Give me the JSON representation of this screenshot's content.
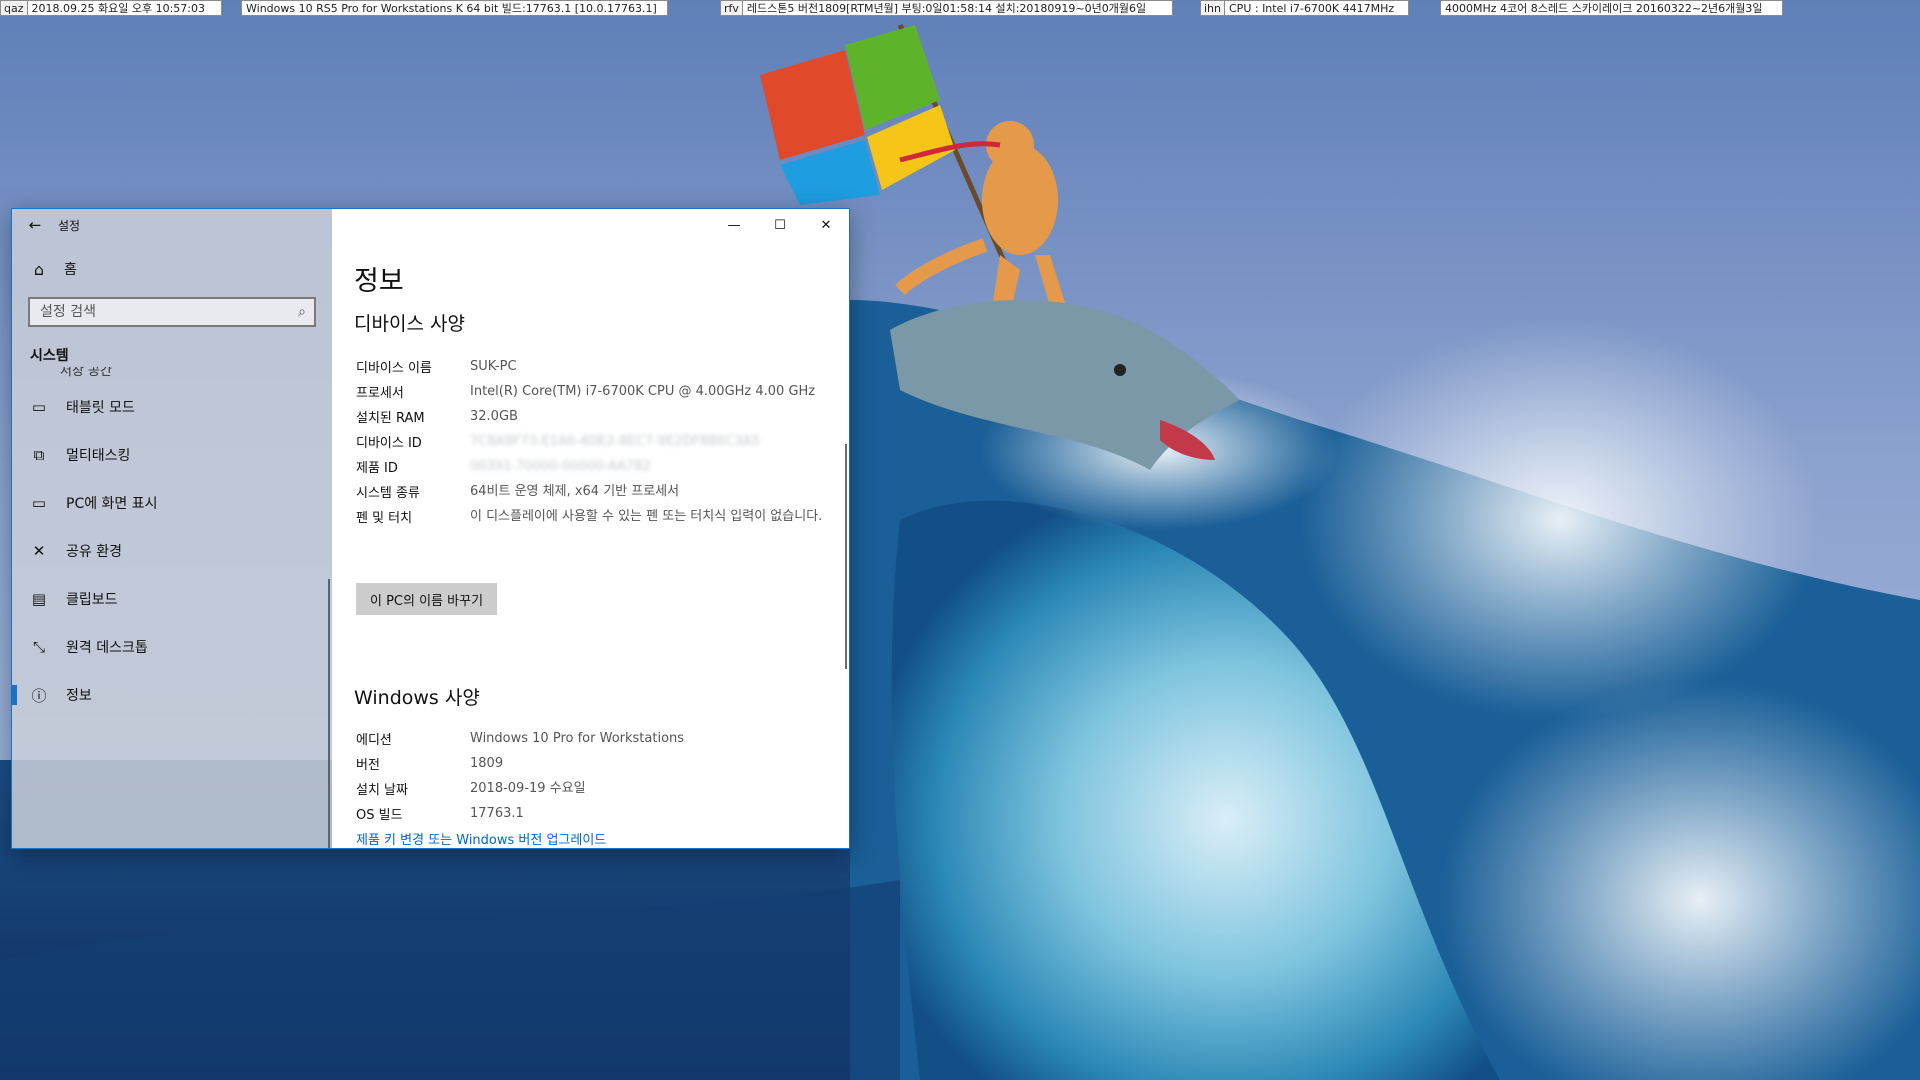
{
  "taskbar_info": [
    {
      "tag": "qaz",
      "value": "2018.09.25 화요일 오후 10:57:03"
    },
    {
      "tag": "",
      "value": "Windows 10 RS5 Pro for Workstations K 64 bit 빌드:17763.1 [10.0.17763.1]"
    },
    {
      "tag": "rfv",
      "value": "레드스톤5 버전1809[RTM년월] 부팅:0일01:58:14 설치:20180919~0년0개월6일"
    },
    {
      "tag": "ihn",
      "value": "CPU : Intel i7-6700K 4417MHz"
    },
    {
      "tag": "",
      "value": "4000MHz 4코어 8스레드 스카이레이크 20160322~2년6개월3일"
    }
  ],
  "window": {
    "title": "설정",
    "nav": {
      "home": "홈",
      "search_placeholder": "설정 검색",
      "section": "시스템",
      "clipped_item": "저장 공간",
      "items": [
        {
          "label": "태블릿 모드",
          "icon": "tablet-icon"
        },
        {
          "label": "멀티태스킹",
          "icon": "multitasking-icon"
        },
        {
          "label": "PC에 화면 표시",
          "icon": "project-icon"
        },
        {
          "label": "공유 환경",
          "icon": "shared-experiences-icon"
        },
        {
          "label": "클립보드",
          "icon": "clipboard-icon"
        },
        {
          "label": "원격 데스크톱",
          "icon": "remote-desktop-icon"
        },
        {
          "label": "정보",
          "icon": "info-icon",
          "selected": true
        }
      ]
    },
    "content": {
      "title": "정보",
      "device_specs_heading": "디바이스 사양",
      "device_specs": [
        {
          "key": "디바이스 이름",
          "value": "SUK-PC"
        },
        {
          "key": "프로세서",
          "value": "Intel(R) Core(TM) i7-6700K CPU @ 4.00GHz   4.00 GHz"
        },
        {
          "key": "설치된 RAM",
          "value": "32.0GB"
        },
        {
          "key": "디바이스 ID",
          "value": "7C8A9F73-E1A6-4DE2-8EC7-9E2DF8B6C3A5",
          "blurred": true
        },
        {
          "key": "제품 ID",
          "value": "00391-70000-00000-AA782",
          "blurred": true
        },
        {
          "key": "시스템 종류",
          "value": "64비트 운영 체제, x64 기반 프로세서"
        },
        {
          "key": "펜 및 터치",
          "value": "이 디스플레이에 사용할 수 있는 펜 또는 터치식 입력이 없습니다."
        }
      ],
      "rename_button": "이 PC의 이름 바꾸기",
      "windows_specs_heading": "Windows 사양",
      "windows_specs": [
        {
          "key": "에디션",
          "value": "Windows 10 Pro for Workstations"
        },
        {
          "key": "버전",
          "value": "1809"
        },
        {
          "key": "설치 날짜",
          "value": "2018-09-19 수요일"
        },
        {
          "key": "OS 빌드",
          "value": "17763.1"
        }
      ],
      "upgrade_link": "제품 키 변경 또는 Windows 버전 업그레이드"
    },
    "caption_buttons": {
      "minimize": "—",
      "maximize": "☐",
      "close": "✕"
    }
  },
  "colors": {
    "accent": "#1a73c8",
    "link": "#0066cc"
  }
}
